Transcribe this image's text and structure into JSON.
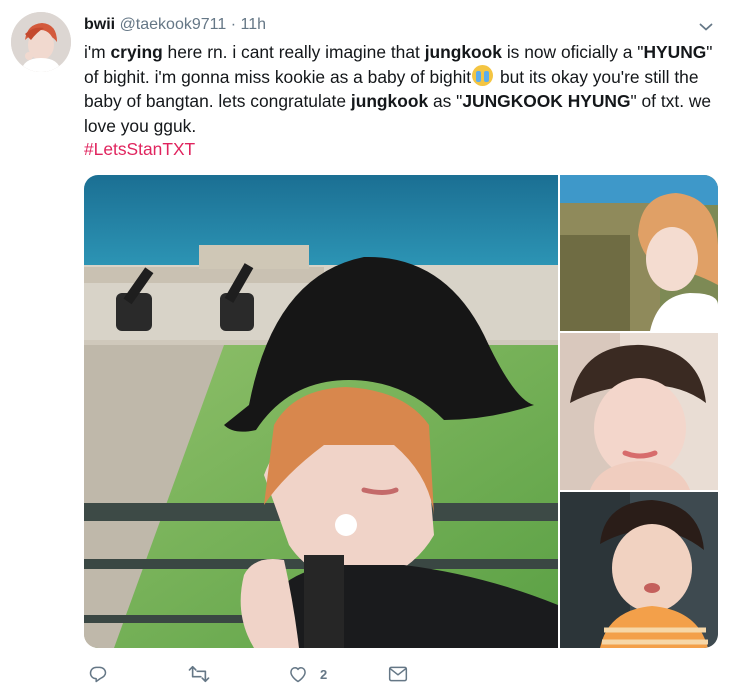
{
  "tweet": {
    "user_name": "bwii",
    "handle": "@taekook9711",
    "separator": "·",
    "time": "11h",
    "text": {
      "s1": "i'm ",
      "b1": "crying",
      "s2": " here rn. i cant really imagine that ",
      "b2": "jungkook",
      "s3": " is now oficially a \"",
      "b3": "HYUNG",
      "s4": "\" of bighit. i'm gonna miss kookie as a baby of bighit",
      "s5": " but its okay you're still the baby of bangtan. lets congratulate ",
      "b4": "jungkook",
      "s6": " as \"",
      "b5": "JUNGKOOK HYUNG",
      "s7": "\" of txt. we love you gguk."
    },
    "hashtag": "#LetsStanTXT",
    "emoji": "loudly-crying-face",
    "photos": [
      {
        "name": "selfie-bucket-hat",
        "description_icon": "photo"
      },
      {
        "name": "portrait-orange-hair",
        "description_icon": "photo"
      },
      {
        "name": "portrait-chin-on-hand",
        "description_icon": "photo"
      },
      {
        "name": "portrait-orange-stripe-shirt",
        "description_icon": "photo"
      }
    ],
    "actions": {
      "reply_icon": "reply-icon",
      "retweet_icon": "retweet-icon",
      "like_icon": "heart-icon",
      "like_count": "2",
      "dm_icon": "envelope-icon"
    }
  },
  "colors": {
    "text": "#14171a",
    "muted": "#657786",
    "hashtag": "#e0245e"
  }
}
